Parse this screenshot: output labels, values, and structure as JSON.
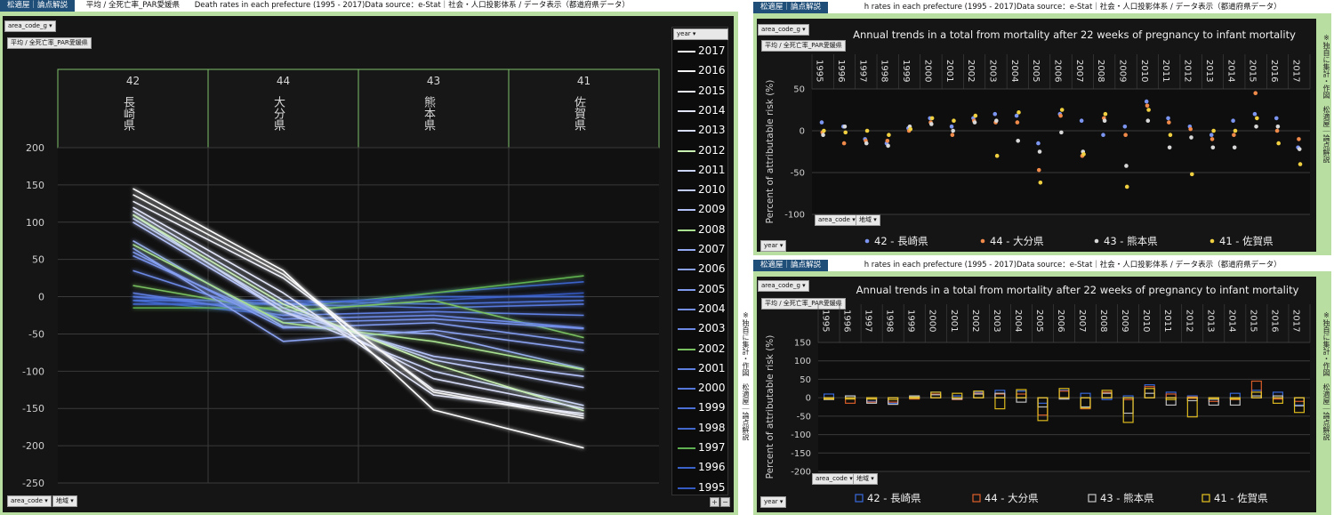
{
  "left": {
    "header": {
      "brand": "松適屋｜論点解説",
      "title": "平均 / 全死亡率_PAR愛媛県",
      "subtitle": "Death rates in each prefecture (1995 - 2017)Data source：e-Stat｜社会・人口投影体系 / データ表示（都道府県データ）"
    },
    "filter_chip": "area_code_g",
    "measure_chip": "平均 / 全死亡率_PAR愛媛県",
    "legend_title": "year",
    "bottom_chip1": "area_code",
    "bottom_chip2": "地域",
    "btn_plus": "+",
    "btn_minus": "−",
    "side_note": "※独自に集計・作図　松適屋｜論点解説"
  },
  "right_top": {
    "header": {
      "brand": "松適屋｜論点解説",
      "subtitle": "h rates in each prefecture (1995 - 2017)Data source：e-Stat｜社会・人口投影体系 / データ表示（都道府県データ）"
    },
    "filter_chip": "area_code_g",
    "measure_chip": "平均 / 全死亡率_PAR愛媛県",
    "bottom_chip1": "area_code",
    "bottom_chip2": "地域",
    "year_chip": "year",
    "side_note": "※独自に集計・作図　松適屋｜論点解説"
  },
  "right_bottom": {
    "header": {
      "brand": "松適屋｜論点解説",
      "subtitle": "h rates in each prefecture (1995 - 2017)Data source：e-Stat｜社会・人口投影体系 / データ表示（都道府県データ）"
    },
    "filter_chip": "area_code_g",
    "measure_chip": "平均 / 全死亡率_PAR愛媛県",
    "bottom_chip1": "area_code",
    "bottom_chip2": "地域",
    "year_chip": "year",
    "side_note": "※独自に集計・作図　松適屋｜論点解説"
  },
  "chart_data": [
    {
      "type": "line",
      "xlabel": "",
      "ylabel": "",
      "ylim": [
        -250,
        200
      ],
      "yticks": [
        200,
        150,
        100,
        50,
        0,
        -50,
        -100,
        -150,
        -200,
        -250
      ],
      "categories": [
        {
          "code": "42",
          "name": "長崎県"
        },
        {
          "code": "44",
          "name": "大分県"
        },
        {
          "code": "43",
          "name": "熊本県"
        },
        {
          "code": "41",
          "name": "佐賀県"
        }
      ],
      "legend_position": "right",
      "series": [
        {
          "name": "2017",
          "color": "#ffffff",
          "values": [
            145,
            35,
            -152,
            -203
          ]
        },
        {
          "name": "2016",
          "color": "#f5f5f5",
          "values": [
            137,
            30,
            -128,
            -163
          ]
        },
        {
          "name": "2015",
          "color": "#eceef8",
          "values": [
            128,
            25,
            -125,
            -160
          ]
        },
        {
          "name": "2014",
          "color": "#e2e6f8",
          "values": [
            120,
            5,
            -132,
            -157
          ]
        },
        {
          "name": "2013",
          "color": "#d7ddf8",
          "values": [
            115,
            -5,
            -110,
            -150
          ]
        },
        {
          "name": "2012",
          "color": "#c8f0b0",
          "values": [
            110,
            -10,
            -90,
            -153
          ]
        },
        {
          "name": "2011",
          "color": "#cad4f8",
          "values": [
            110,
            -20,
            -100,
            -146
          ]
        },
        {
          "name": "2010",
          "color": "#bfcaf8",
          "values": [
            105,
            -15,
            -85,
            -122
          ]
        },
        {
          "name": "2009",
          "color": "#b2c0f8",
          "values": [
            100,
            -20,
            -80,
            -107
          ]
        },
        {
          "name": "2008",
          "color": "#a8e090",
          "values": [
            70,
            -35,
            -60,
            -98
          ]
        },
        {
          "name": "2007",
          "color": "#93a9f2",
          "values": [
            75,
            -40,
            -50,
            -97
          ]
        },
        {
          "name": "2006",
          "color": "#89a1ef",
          "values": [
            65,
            -60,
            -45,
            -72
          ]
        },
        {
          "name": "2005",
          "color": "#7f99ec",
          "values": [
            60,
            -42,
            -35,
            -62
          ]
        },
        {
          "name": "2004",
          "color": "#7490e8",
          "values": [
            55,
            -35,
            -30,
            -43
          ]
        },
        {
          "name": "2003",
          "color": "#6a88e4",
          "values": [
            35,
            -30,
            -25,
            -42
          ]
        },
        {
          "name": "2002",
          "color": "#79c060",
          "values": [
            15,
            -20,
            -5,
            -55
          ]
        },
        {
          "name": "2001",
          "color": "#5f7fe0",
          "values": [
            5,
            -25,
            -20,
            -25
          ]
        },
        {
          "name": "2000",
          "color": "#5577da",
          "values": [
            0,
            -10,
            -15,
            -10
          ]
        },
        {
          "name": "1999",
          "color": "#4b6fd4",
          "values": [
            -5,
            -5,
            -10,
            -5
          ]
        },
        {
          "name": "1998",
          "color": "#4268ce",
          "values": [
            -10,
            -10,
            0,
            0
          ]
        },
        {
          "name": "1997",
          "color": "#5fb050",
          "values": [
            -15,
            -15,
            5,
            28
          ]
        },
        {
          "name": "1996",
          "color": "#3a62c8",
          "values": [
            -5,
            -25,
            5,
            20
          ]
        },
        {
          "name": "1995",
          "color": "#3459c0",
          "values": [
            0,
            -20,
            -5,
            5
          ]
        }
      ]
    },
    {
      "type": "scatter",
      "title": "Annual trends in a total from mortality after 22 weeks of pregnancy to infant mortality",
      "ylabel": "Percent of attributable risk (%)",
      "ylim": [
        -100,
        50
      ],
      "yticks": [
        50,
        0,
        -50,
        -100
      ],
      "categories": [
        "1995",
        "1996",
        "1997",
        "1998",
        "1999",
        "2000",
        "2001",
        "2002",
        "2003",
        "2004",
        "2005",
        "2006",
        "2007",
        "2008",
        "2009",
        "2010",
        "2011",
        "2012",
        "2013",
        "2014",
        "2015",
        "2016",
        "2017"
      ],
      "legend_position": "bottom",
      "series": [
        {
          "name": "42 - 長崎県",
          "color": "#7b95f0",
          "values": [
            10,
            5,
            -10,
            -15,
            3,
            15,
            5,
            15,
            20,
            18,
            -15,
            20,
            12,
            -5,
            5,
            35,
            15,
            5,
            -5,
            12,
            20,
            15,
            -20
          ]
        },
        {
          "name": "44 - 大分県",
          "color": "#f08a4a",
          "values": [
            -2,
            -15,
            -12,
            -12,
            0,
            10,
            -5,
            12,
            10,
            10,
            -47,
            18,
            -30,
            15,
            -5,
            30,
            10,
            2,
            -10,
            -5,
            45,
            0,
            -10
          ]
        },
        {
          "name": "43 - 熊本県",
          "color": "#d8d8d8",
          "values": [
            -5,
            5,
            -15,
            -18,
            5,
            8,
            0,
            10,
            12,
            -12,
            -25,
            -2,
            -25,
            12,
            -42,
            12,
            -20,
            -8,
            -20,
            -20,
            5,
            5,
            -22
          ]
        },
        {
          "name": "41 - 佐賀県",
          "color": "#f0d040",
          "values": [
            0,
            -2,
            0,
            -5,
            2,
            15,
            12,
            18,
            -30,
            22,
            -62,
            25,
            -28,
            20,
            -67,
            25,
            -5,
            -52,
            0,
            0,
            15,
            -15,
            -40
          ]
        }
      ]
    },
    {
      "type": "bar",
      "title": "Annual trends in a total from mortality after 22 weeks of pregnancy to infant mortality",
      "ylabel": "Percent of attributable risk (%)",
      "ylim": [
        -200,
        150
      ],
      "yticks": [
        150,
        100,
        50,
        0,
        -50,
        -100,
        -150,
        -200
      ],
      "categories": [
        "1995",
        "1996",
        "1997",
        "1998",
        "1999",
        "2000",
        "2001",
        "2002",
        "2003",
        "2004",
        "2005",
        "2006",
        "2007",
        "2008",
        "2009",
        "2010",
        "2011",
        "2012",
        "2013",
        "2014",
        "2015",
        "2016",
        "2017"
      ],
      "legend_position": "bottom",
      "series": [
        {
          "name": "42 - 長崎県",
          "color": "#3a6be0",
          "values": [
            10,
            5,
            -10,
            -15,
            3,
            15,
            5,
            15,
            20,
            18,
            -15,
            20,
            12,
            -5,
            5,
            35,
            15,
            5,
            -5,
            12,
            20,
            15,
            -20
          ]
        },
        {
          "name": "44 - 大分県",
          "color": "#e0602a",
          "values": [
            -2,
            -15,
            -12,
            -12,
            0,
            10,
            -5,
            12,
            10,
            10,
            -47,
            18,
            -30,
            15,
            -5,
            30,
            10,
            2,
            -10,
            -5,
            45,
            0,
            -10
          ]
        },
        {
          "name": "43 - 熊本県",
          "color": "#c8c8c8",
          "values": [
            -5,
            5,
            -15,
            -18,
            5,
            8,
            0,
            10,
            12,
            -12,
            -25,
            -2,
            -25,
            12,
            -42,
            12,
            -20,
            -8,
            -20,
            -20,
            5,
            5,
            -22
          ]
        },
        {
          "name": "41 - 佐賀県",
          "color": "#e8c420",
          "values": [
            0,
            -2,
            0,
            -5,
            2,
            15,
            12,
            18,
            -30,
            22,
            -62,
            25,
            -28,
            20,
            -67,
            25,
            -5,
            -52,
            0,
            0,
            15,
            -15,
            -40
          ]
        }
      ]
    }
  ]
}
